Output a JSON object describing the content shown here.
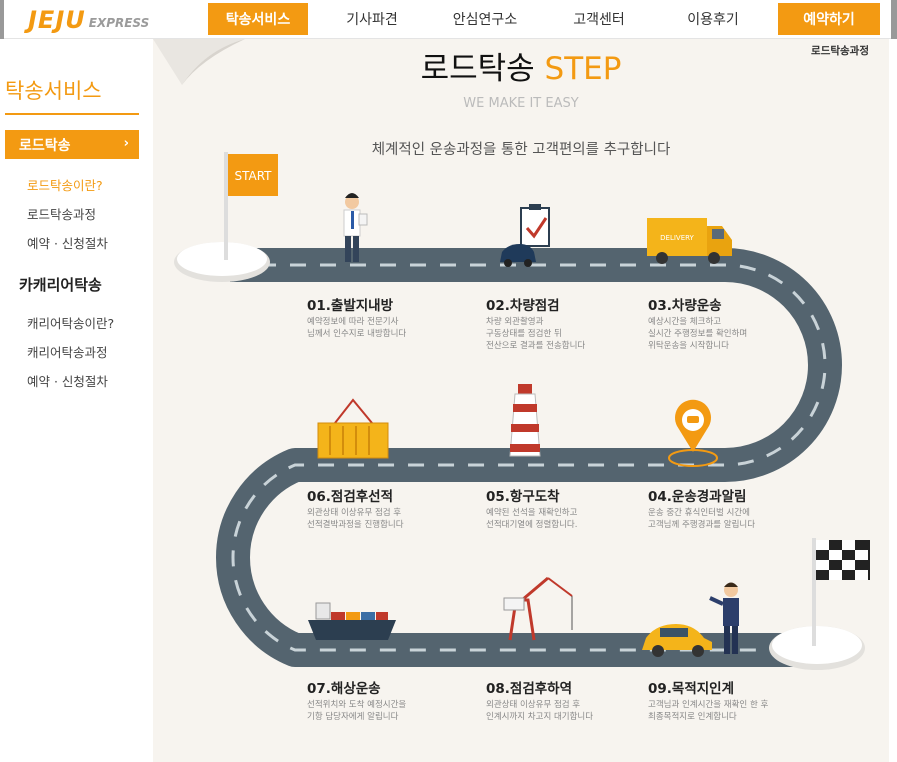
{
  "header": {
    "logo_main": "JEJU",
    "logo_sub": "EXPRESS",
    "nav": [
      "탁송서비스",
      "기사파견",
      "안심연구소",
      "고객센터",
      "이용후기"
    ],
    "reserve_label": "예약하기"
  },
  "sidebar": {
    "title": "탁송서비스",
    "active_item": "로드탁송",
    "active_chevron": "›",
    "road_items": [
      "로드탁송이란?",
      "로드탁송과정",
      "예약 · 신청절차"
    ],
    "carrier_title": "카캐리어탁송",
    "carrier_items": [
      "캐리어탁송이란?",
      "캐리어탁송과정",
      "예약 · 신청절차"
    ]
  },
  "main": {
    "breadcrumb": "로드탁송과정",
    "title_ko": "로드탁송",
    "title_en": "STEP",
    "subtitle": "WE MAKE IT EASY",
    "intro": "체계적인 운송과정을 통한 고객편의를 추구합니다",
    "start_label": "START",
    "truck_label": "DELIVERY",
    "steps": [
      {
        "title": "01.출발지내방",
        "line1": "예약정보에 따라 전문기사",
        "line2": "님께서 인수지로 내방합니다",
        "line3": ""
      },
      {
        "title": "02.차량점검",
        "line1": "차량 외관촬영과",
        "line2": "구동상태를 점검한 뒤",
        "line3": "전산으로 결과를 전송합니다"
      },
      {
        "title": "03.차량운송",
        "line1": "예상시간을 체크하고",
        "line2": "실시간 주행정보를 확인하며",
        "line3": "위탁운송을 시작합니다"
      },
      {
        "title": "04.운송경과알림",
        "line1": "운송 중간 휴식인터벌 시간에",
        "line2": "고객님께 주행경과를 알립니다",
        "line3": ""
      },
      {
        "title": "05.항구도착",
        "line1": "예약된 선석을 재확인하고",
        "line2": "선적대기열에 정렬합니다.",
        "line3": ""
      },
      {
        "title": "06.점검후선적",
        "line1": "외관상태 이상유무 점검 후",
        "line2": "선적결박과정을 진행합니다",
        "line3": ""
      },
      {
        "title": "07.해상운송",
        "line1": "선적위치와 도착 예정시간을",
        "line2": "기항 담당자에게 알립니다",
        "line3": ""
      },
      {
        "title": "08.점검후하역",
        "line1": "외관상태 이상유무 점검 후",
        "line2": "인계시까지 차고지 대기합니다",
        "line3": ""
      },
      {
        "title": "09.목적지인계",
        "line1": "고객님과 인계시간을 재확인 한 후",
        "line2": "최종목적지로 인계합니다",
        "line3": ""
      }
    ]
  }
}
